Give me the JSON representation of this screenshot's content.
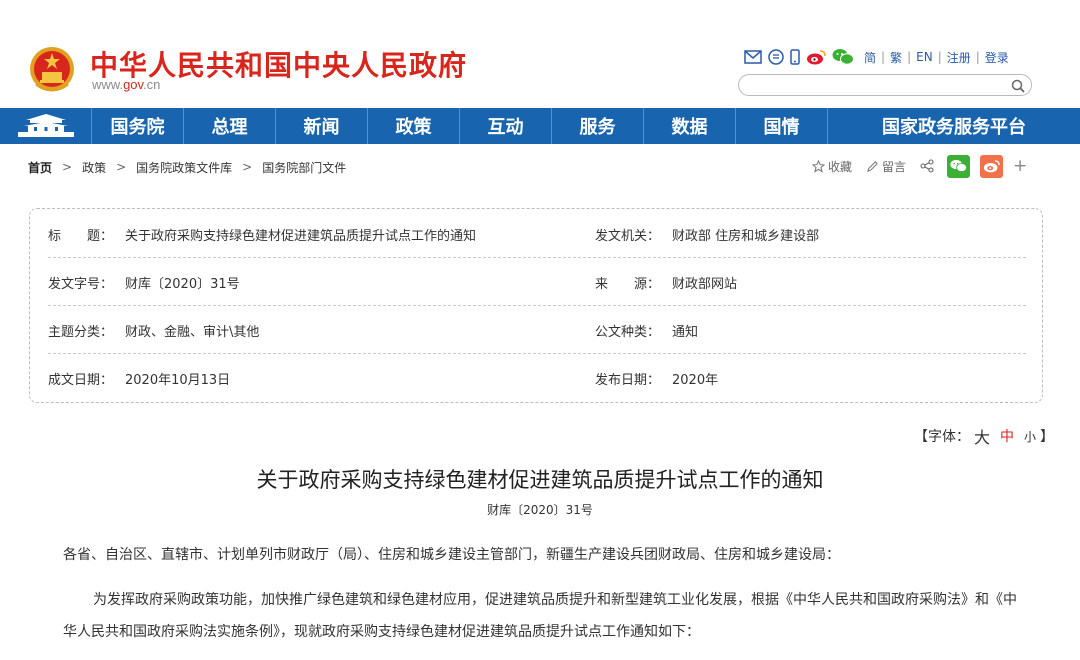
{
  "header": {
    "site_title": "中华人民共和国中央人民政府",
    "url_prefix": "www.",
    "url_highlight": "gov",
    "url_suffix": ".cn",
    "links": [
      "简",
      "繁",
      "EN",
      "注册",
      "登录"
    ],
    "search_placeholder": ""
  },
  "nav": {
    "items": [
      "国务院",
      "总理",
      "新闻",
      "政策",
      "互动",
      "服务",
      "数据",
      "国情",
      "国家政务服务平台"
    ]
  },
  "breadcrumb": {
    "home": "首页",
    "items": [
      "政策",
      "国务院政策文件库",
      "国务院部门文件"
    ]
  },
  "actions": {
    "favorite": "收藏",
    "comment": "留言",
    "plus": "+"
  },
  "info": {
    "title_label": "标　　题：",
    "title_value": "关于政府采购支持绿色建材促进建筑品质提升试点工作的通知",
    "issuer_label": "发文机关：",
    "issuer_value": "财政部 住房和城乡建设部",
    "docno_label": "发文字号：",
    "docno_value": "财库〔2020〕31号",
    "source_label": "来　　源：",
    "source_value": "财政部网站",
    "topic_label": "主题分类：",
    "topic_value": "财政、金融、审计\\其他",
    "type_label": "公文种类：",
    "type_value": "通知",
    "written_label": "成文日期：",
    "written_value": "2020年10月13日",
    "published_label": "发布日期：",
    "published_value": "2020年"
  },
  "fontsize": {
    "prefix": "【字体：",
    "big": "大",
    "mid": "中",
    "small": "小",
    "suffix": "】"
  },
  "article": {
    "title": "关于政府采购支持绿色建材促进建筑品质提升试点工作的通知",
    "doc_no": "财库〔2020〕31号",
    "p1": "各省、自治区、直辖市、计划单列市财政厅（局）、住房和城乡建设主管部门，新疆生产建设兵团财政局、住房和城乡建设局：",
    "p2": "为发挥政府采购政策功能，加快推广绿色建筑和绿色建材应用，促进建筑品质提升和新型建筑工业化发展，根据《中华人民共和国政府采购法》和《中华人民共和国政府采购法实施条例》，现就政府采购支持绿色建材促进建筑品质提升试点工作通知如下："
  },
  "colors": {
    "brand_red": "#d8261c",
    "nav_blue": "#1864ae",
    "wechat_green": "#3cb034",
    "weibo_orange": "#f0714a"
  }
}
